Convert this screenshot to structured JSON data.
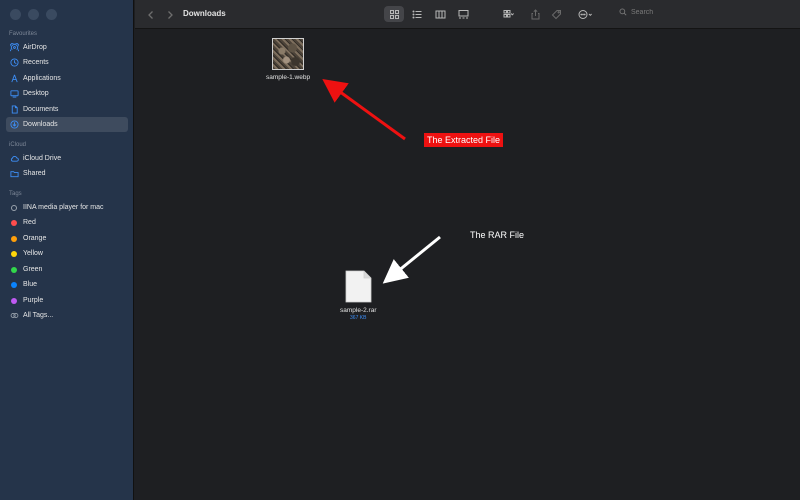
{
  "window": {
    "title": "Downloads"
  },
  "toolbar": {
    "search_placeholder": "Search"
  },
  "sidebar": {
    "favourites_header": "Favourites",
    "favourites": [
      {
        "label": "AirDrop",
        "icon": "airdrop-icon"
      },
      {
        "label": "Recents",
        "icon": "clock-icon"
      },
      {
        "label": "Applications",
        "icon": "applications-icon"
      },
      {
        "label": "Desktop",
        "icon": "desktop-icon"
      },
      {
        "label": "Documents",
        "icon": "document-icon"
      },
      {
        "label": "Downloads",
        "icon": "download-icon",
        "selected": true
      }
    ],
    "icloud_header": "iCloud",
    "icloud": [
      {
        "label": "iCloud Drive",
        "icon": "cloud-icon"
      },
      {
        "label": "Shared",
        "icon": "shared-folder-icon"
      }
    ],
    "tags_header": "Tags",
    "tags": [
      {
        "label": "IINA media player for mac",
        "color": ""
      },
      {
        "label": "Red",
        "color": "#ff4d4d"
      },
      {
        "label": "Orange",
        "color": "#ff9f0a"
      },
      {
        "label": "Yellow",
        "color": "#ffd60a"
      },
      {
        "label": "Green",
        "color": "#32d74b"
      },
      {
        "label": "Blue",
        "color": "#0a84ff"
      },
      {
        "label": "Purple",
        "color": "#bf5af2"
      },
      {
        "label": "All Tags...",
        "color": ""
      }
    ]
  },
  "files": [
    {
      "name": "sample-1.webp",
      "size": ""
    },
    {
      "name": "sample-2.rar",
      "size": "367 KB"
    }
  ],
  "annotations": {
    "extracted": "The Extracted File",
    "rar": "The RAR File",
    "accent_red": "#ee1111",
    "accent_white": "#ffffff"
  }
}
